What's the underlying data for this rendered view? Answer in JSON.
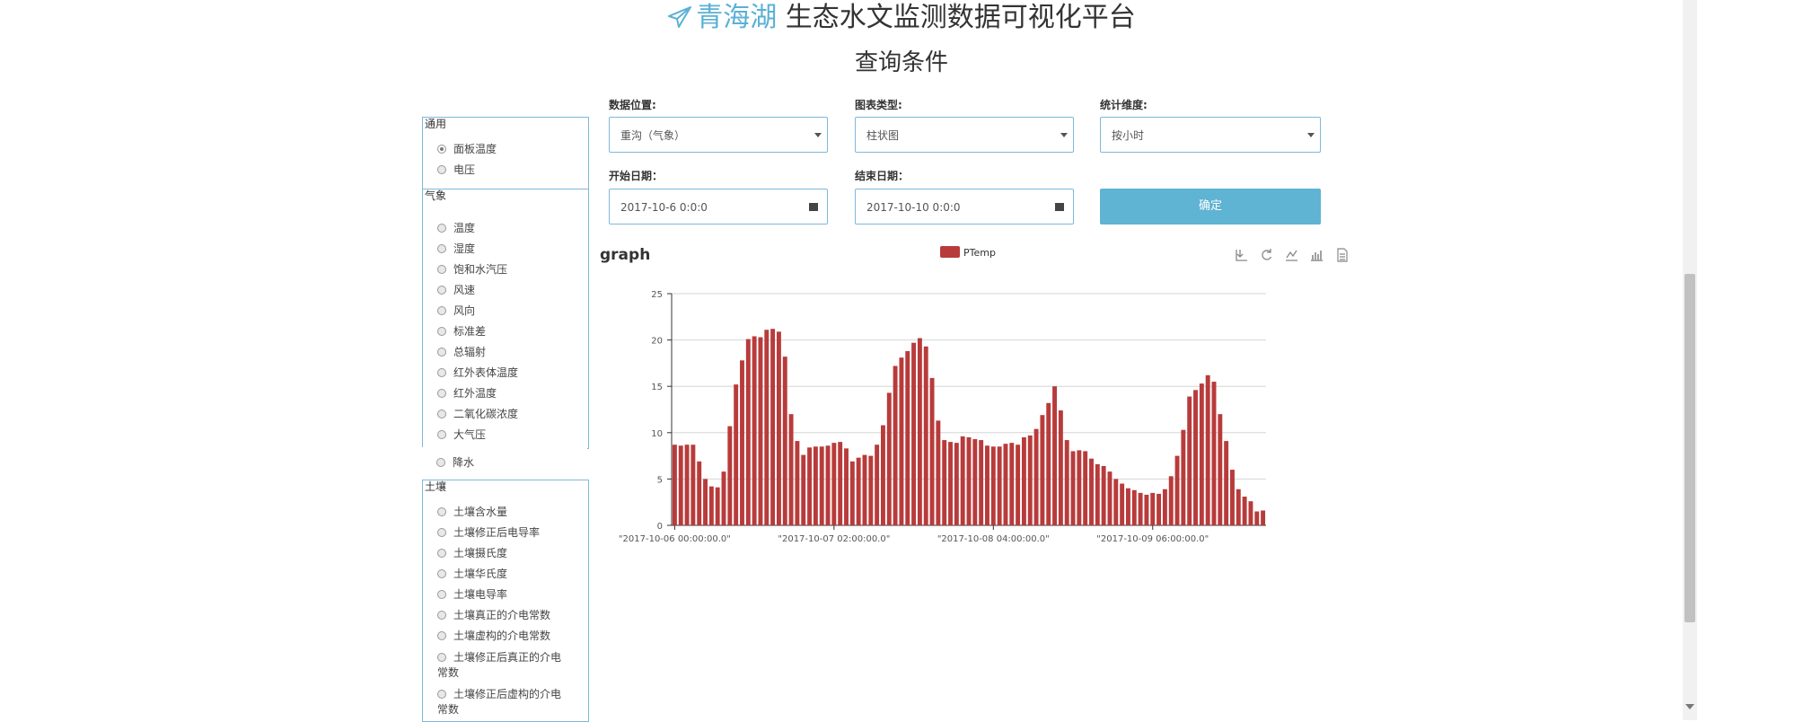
{
  "header": {
    "brand": "青海湖",
    "title": " 生态水文监测数据可视化平台",
    "subtitle": "查询条件"
  },
  "left_panel": {
    "groups": [
      {
        "title": "通用",
        "items": [
          {
            "label": "面板温度",
            "checked": true
          },
          {
            "label": "电压",
            "checked": false
          }
        ]
      },
      {
        "title": "气象",
        "items": [
          {
            "label": "温度"
          },
          {
            "label": "湿度"
          },
          {
            "label": "饱和水汽压"
          },
          {
            "label": "风速"
          },
          {
            "label": "风向"
          },
          {
            "label": "标准差"
          },
          {
            "label": "总辐射"
          },
          {
            "label": "红外表体温度"
          },
          {
            "label": "红外温度"
          },
          {
            "label": "二氧化碳浓度"
          },
          {
            "label": "大气压"
          }
        ]
      },
      {
        "title": "",
        "items": [
          {
            "label": "降水"
          }
        ]
      },
      {
        "title": "土壤",
        "items": [
          {
            "label": "土壤含水量"
          },
          {
            "label": "土壤修正后电导率"
          },
          {
            "label": "土壤摄氏度"
          },
          {
            "label": "土壤华氏度"
          },
          {
            "label": "土壤电导率"
          },
          {
            "label": "土壤真正的介电常数"
          },
          {
            "label": "土壤虚构的介电常数"
          },
          {
            "label": "土壤修正后真正的介电常数"
          },
          {
            "label": "土壤修正后虚构的介电常数"
          }
        ]
      }
    ]
  },
  "form": {
    "location": {
      "label": "数据位置:",
      "value": "重沟（气象）"
    },
    "chart_type": {
      "label": "图表类型:",
      "value": "柱状图"
    },
    "stat_dim": {
      "label": "统计维度:",
      "value": "按小时"
    },
    "start_date": {
      "label": "开始日期：",
      "value": "2017-10-6 0:0:0"
    },
    "end_date": {
      "label": "结束日期：",
      "value": "2017-10-10 0:0:0"
    },
    "confirm_label": "确定"
  },
  "graph": {
    "title": "graph"
  },
  "colors": {
    "accent": "#5fb3d3",
    "border": "#7fb8d8",
    "bar": "#b83b3b"
  },
  "chart_data": {
    "type": "bar",
    "series": [
      {
        "name": "PTemp",
        "values": [
          8.7,
          8.6,
          8.7,
          8.7,
          6.9,
          5.0,
          4.2,
          4.1,
          5.8,
          10.7,
          15.2,
          17.8,
          20.1,
          20.4,
          20.3,
          21.1,
          21.2,
          20.9,
          18.2,
          12.0,
          9.1,
          7.6,
          8.4,
          8.5,
          8.5,
          8.6,
          8.9,
          9.0,
          8.3,
          6.9,
          7.3,
          7.6,
          7.5,
          8.7,
          10.8,
          14.3,
          17.2,
          18.1,
          18.8,
          19.7,
          20.2,
          19.3,
          15.9,
          11.3,
          9.2,
          9.0,
          8.9,
          9.6,
          9.5,
          9.3,
          9.2,
          8.6,
          8.5,
          8.5,
          8.8,
          8.9,
          8.7,
          9.5,
          9.7,
          10.4,
          11.9,
          13.2,
          15.0,
          12.4,
          9.2,
          8.0,
          8.1,
          8.0,
          7.2,
          6.6,
          6.4,
          5.8,
          5.0,
          4.5,
          4.0,
          3.8,
          3.5,
          3.3,
          3.5,
          3.4,
          3.9,
          5.3,
          7.5,
          10.3,
          13.9,
          14.6,
          15.3,
          16.2,
          15.5,
          12.0,
          9.1,
          6.0,
          3.9,
          3.1,
          2.6,
          1.5,
          1.6
        ]
      }
    ],
    "x_ticks": [
      "\"2017-10-06 00:00:00.0\"",
      "\"2017-10-07 02:00:00.0\"",
      "\"2017-10-08 04:00:00.0\"",
      "\"2017-10-09 06:00:00.0\""
    ],
    "x_tick_index": [
      0,
      26,
      52,
      78
    ],
    "ylim": [
      0,
      25
    ],
    "y_ticks": [
      0,
      5,
      10,
      15,
      20,
      25
    ],
    "grid": true,
    "legend": "top-center"
  }
}
